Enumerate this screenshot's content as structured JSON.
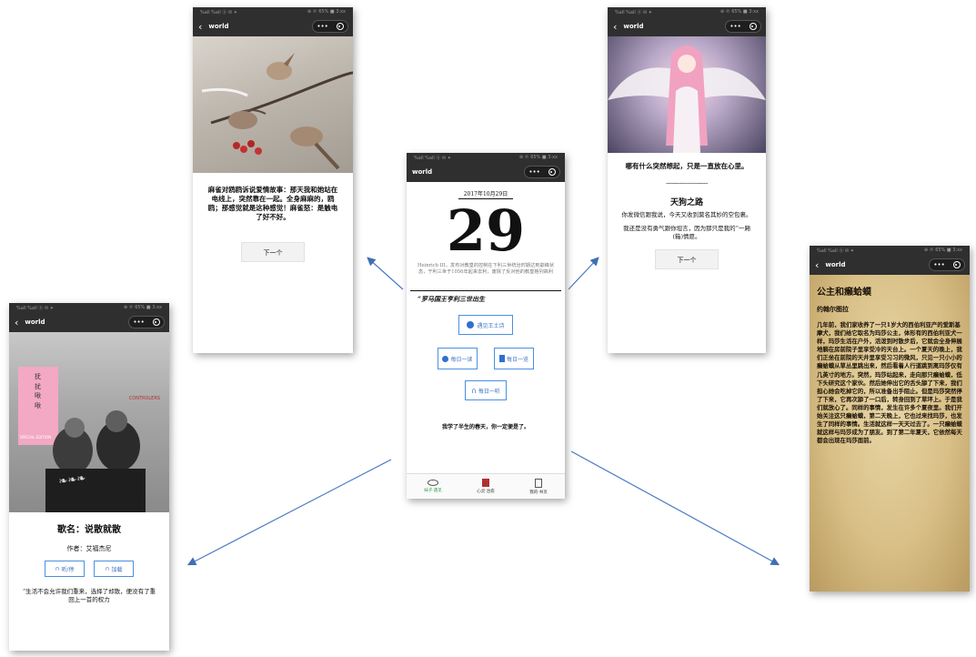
{
  "status": {
    "left": "%all %all ⓑ ✉ ✦",
    "right": "⊕ ℗ 65% ■ 3:xx"
  },
  "nav": {
    "title": "world"
  },
  "center": {
    "date": "2017年10月29日",
    "day": "29",
    "history_text": "Heinrich III，发布对教皇的控制在下利三世统治时期达到巅峰状态，于利三世于1056年起来去利，废除了反对他的教皇格列高利",
    "quote": "“罗马国王亨利三世出生",
    "btn_poem": "遇见王土诗",
    "btn_daily_listen": "每日一读",
    "btn_daily_book": "每日一览",
    "btn_daily_hear": "每日一听",
    "closing": "我学了半生的春天，你一定便是了。",
    "tabs": [
      "妹子·遇见",
      "心灵·治愈",
      "我的·书页"
    ]
  },
  "bird": {
    "text": "麻雀对鸥鸥诉说爱情故事：那天我和她站在电线上，突然靠在一起。全身麻麻的，鸥鸥；那感觉就是这种感觉！麻雀怒：是触电了好不好。",
    "next": "下一个"
  },
  "angel": {
    "text1": "哪有什么突然想起，只是一直放在心里。",
    "divider": "------------------------------",
    "title": "天狗之路",
    "text2": "你发微信跟我说，今天又收到莫名其妙的空包裹。",
    "text3": "我还是没有勇气跟你坦言，因为那只是我的“一厢(箱)情愿。",
    "next": "下一个"
  },
  "music": {
    "cover_text": "抚扰啾啾",
    "cover_badge": "SPECIAL EDITION",
    "cover_right": "CONTROLERS",
    "song": "歌名：说散就散",
    "artist": "作者：艾福杰尼",
    "btn_listen": "听/停",
    "btn_download": "加载",
    "lyric": "“生活不会允许我们重来，选择了却散，便没有了重回上一首的权力"
  },
  "story": {
    "title": "公主和癞蛤蟆",
    "author": "约翰尔图拉",
    "body": "几年前，我们家收养了一只1岁大的西伯利亚产的爱斯基摩犬，我们给它取名为玛莎公主，体形有的西伯利亚犬一样，玛莎生活在户外，活泼到时散步后，它就会全身伸展地躺在房前院子里享受冷的天台上。一个夏天的晚上，我们正坐在前院的天井里享受习习的微风，只见一只小小的癞蛤蟆从草丛里跳出来，然后看着人行道跳到离玛莎仅有几英寸的地方。突然，玛莎站起来，走向那只癞蛤蟆，低下头研究这个家伙。然后她伸出它的舌头舔了下来，我们担心她会吃掉它的，所以准备出手阻止。但是玛莎突然停了下来，它再次舔了一口后，转身回到了草坪上。于是我们就放心了。同样的事情，发生在许多个夏夜里。我们开始关注这只癞蛤蟆，第二天晚上，它也过来找玛莎，也发生了同样的事情。生活就这样一天天过去了。一只癞蛤蟆就这样与玛莎成为了朋友。到了第二年夏天，它依然每天都会出现在玛莎面前。"
  }
}
